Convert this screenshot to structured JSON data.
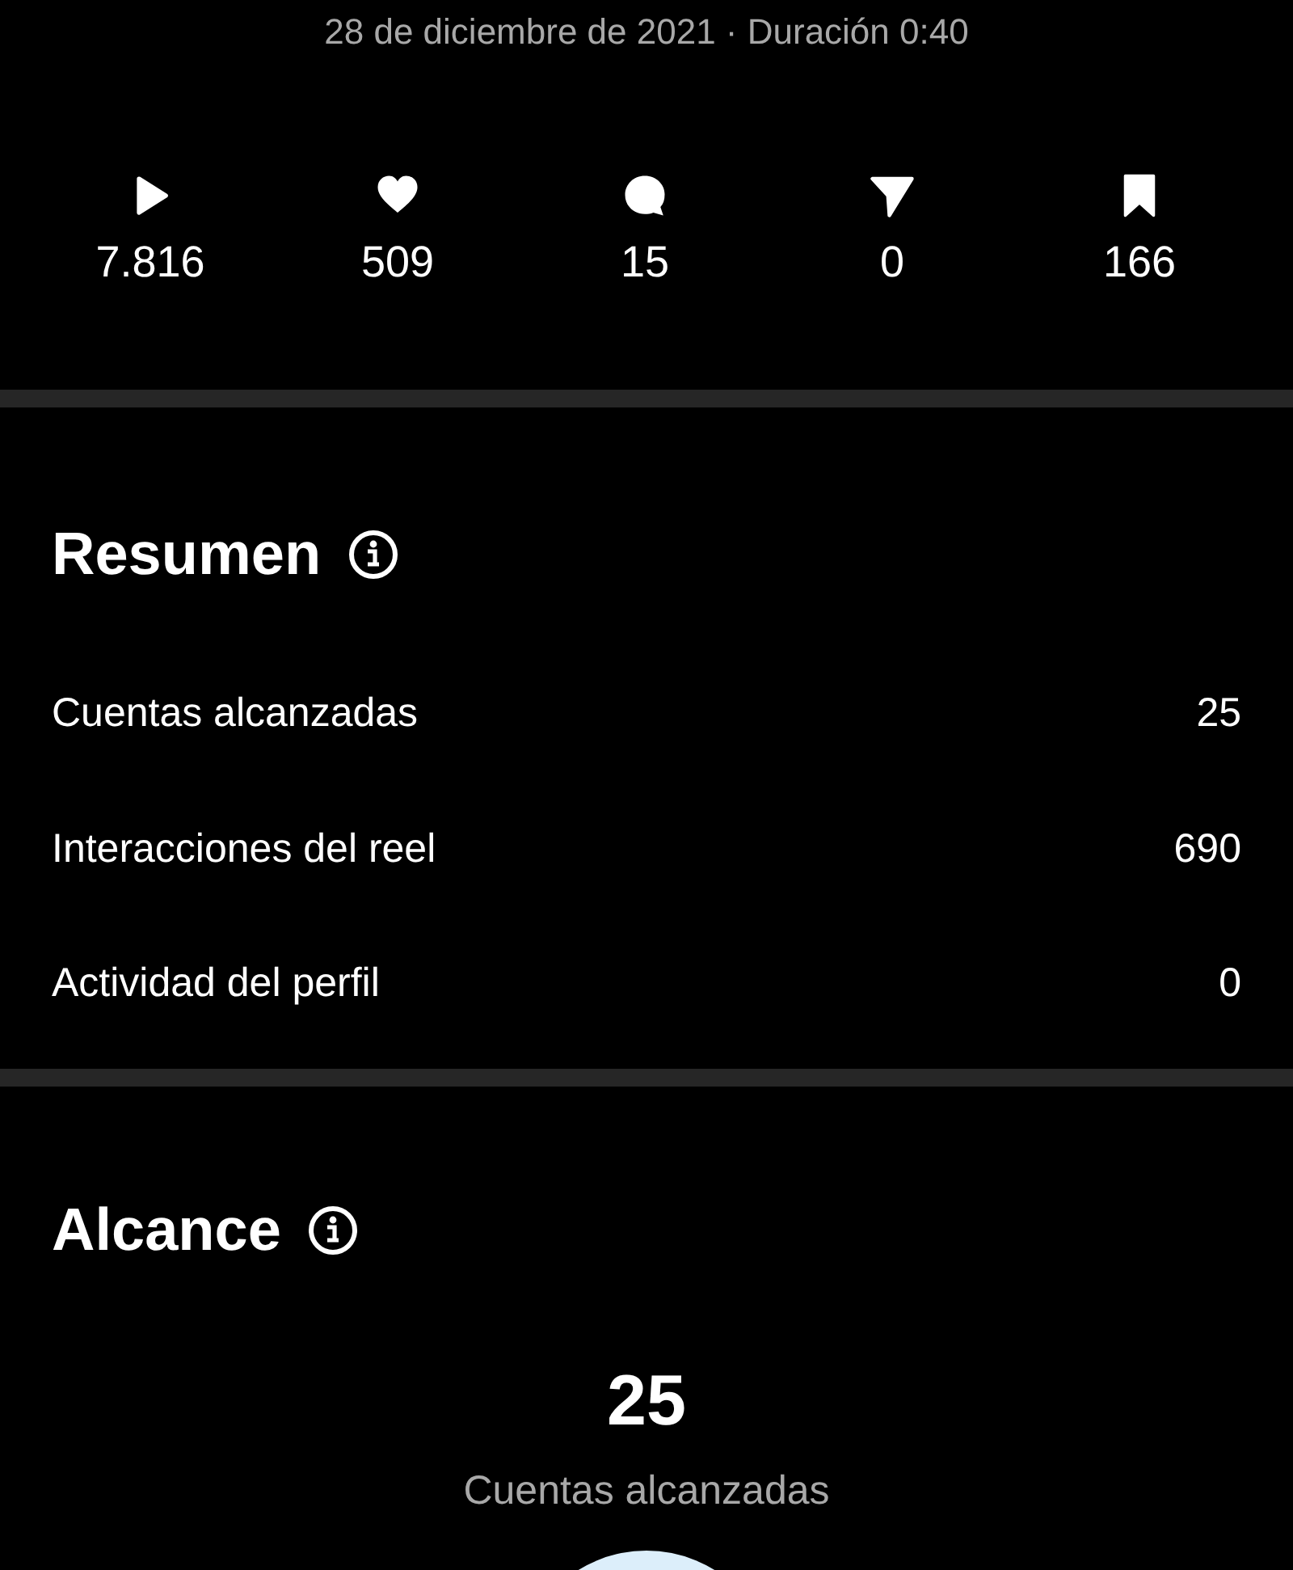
{
  "subtitle": "28 de diciembre de 2021 · Duración 0:40",
  "stats": [
    {
      "value": "7.816"
    },
    {
      "value": "509"
    },
    {
      "value": "15"
    },
    {
      "value": "0"
    },
    {
      "value": "166"
    }
  ],
  "summary": {
    "title": "Resumen",
    "rows": [
      {
        "label": "Cuentas alcanzadas",
        "value": "25"
      },
      {
        "label": "Interacciones del reel",
        "value": "690"
      },
      {
        "label": "Actividad del perfil",
        "value": "0"
      }
    ]
  },
  "reach": {
    "title": "Alcance",
    "total": "25",
    "caption": "Cuentas alcanzadas"
  }
}
